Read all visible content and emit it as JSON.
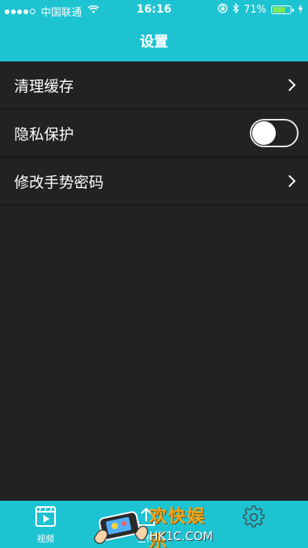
{
  "status_bar": {
    "carrier": "中国联通",
    "time": "16:16",
    "battery_percent_text": "71%",
    "battery_level": 0.71,
    "icons": [
      "signal-dots-icon",
      "wifi-icon",
      "orientation-lock-icon",
      "bluetooth-icon",
      "battery-icon",
      "charging-icon"
    ]
  },
  "navbar": {
    "title": "设置"
  },
  "settings": {
    "items": [
      {
        "label": "清理缓存",
        "control": "chevron"
      },
      {
        "label": "隐私保护",
        "control": "toggle",
        "toggle_on": false
      },
      {
        "label": "修改手势密码",
        "control": "chevron"
      }
    ]
  },
  "tabbar": {
    "tabs": [
      {
        "label": "视频",
        "icon": "video-icon"
      },
      {
        "label": "上传",
        "icon": "upload-icon"
      },
      {
        "label": "",
        "icon": "gear-icon"
      }
    ]
  },
  "watermark": {
    "title": "欢快娱乐",
    "site": "HK1C.COM"
  },
  "colors": {
    "accent": "#1ec3d2",
    "background": "#222222",
    "separator": "#0f0f0f",
    "battery_fill": "#7ee85a",
    "watermark_text": "#f3a71a"
  }
}
